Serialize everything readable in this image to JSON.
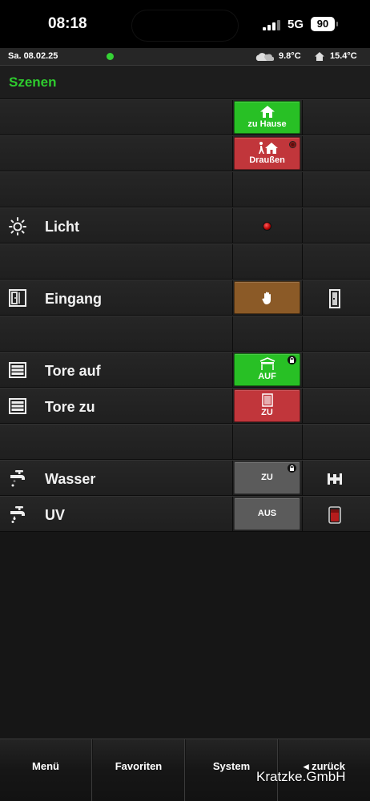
{
  "status_bar": {
    "time": "08:18",
    "network": "5G",
    "battery": "90"
  },
  "info_bar": {
    "date": "Sa. 08.02.25",
    "temp_outside": "9.8°C",
    "temp_inside": "15.4°C"
  },
  "page": {
    "title": "Szenen"
  },
  "rows": {
    "scene_home": {
      "button": "zu Hause"
    },
    "scene_away": {
      "button": "Draußen"
    },
    "licht": {
      "label": "Licht"
    },
    "eingang": {
      "label": "Eingang"
    },
    "tore_auf": {
      "label": "Tore auf",
      "button": "AUF"
    },
    "tore_zu": {
      "label": "Tore zu",
      "button": "ZU"
    },
    "wasser": {
      "label": "Wasser",
      "button": "ZU"
    },
    "uv": {
      "label": "UV",
      "button": "AUS"
    }
  },
  "nav": {
    "menu": "Menü",
    "favorites": "Favoriten",
    "system": "System",
    "back": "◂ zurück"
  },
  "watermark": "Kratzke.GmbH",
  "colors": {
    "accent_green": "#2ecc2e",
    "button_green": "#28c025",
    "button_red": "#c1363b",
    "button_brown": "#8b5a27",
    "button_gray": "#5b5b5b"
  },
  "icons": [
    "home-icon",
    "walk-out-icon",
    "sun-icon",
    "door-icon",
    "hand-icon",
    "garage-door-icon",
    "faucet-icon",
    "lock-icon",
    "valve-icon",
    "uv-lamp-icon",
    "weather-icon"
  ]
}
